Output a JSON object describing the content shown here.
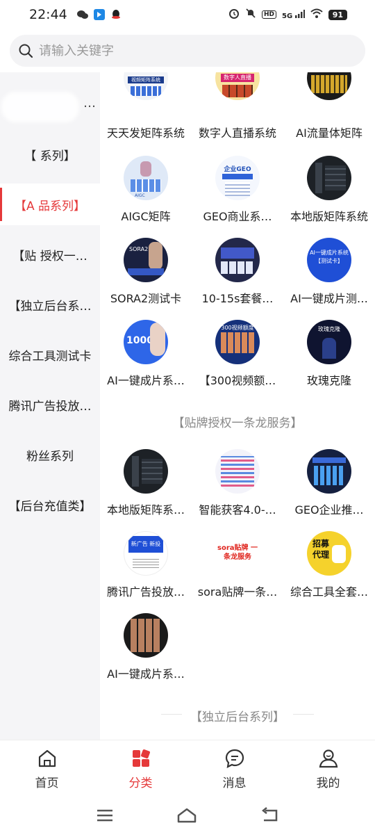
{
  "status": {
    "time": "22:44",
    "network": "5G",
    "hd": "HD",
    "battery": "91"
  },
  "search": {
    "placeholder": "请输入关键字"
  },
  "sidebar": {
    "items": [
      {
        "label": "…"
      },
      {
        "label": "【   系列】"
      },
      {
        "label": "【A   品系列】"
      },
      {
        "label": "【贴   授权一…"
      },
      {
        "label": "【独立后台系…"
      },
      {
        "label": "综合工具测试卡"
      },
      {
        "label": "腾讯广告投放…"
      },
      {
        "label": "粉丝系列"
      },
      {
        "label": "【后台充值类】"
      }
    ]
  },
  "sections": {
    "s1_items": [
      {
        "label": "天天发矩阵系统"
      },
      {
        "label": "数字人直播系统"
      },
      {
        "label": "AI流量体矩阵"
      },
      {
        "label": "AIGC矩阵"
      },
      {
        "label": "GEO商业系…"
      },
      {
        "label": "本地版矩阵系统"
      },
      {
        "label": "SORA2测试卡"
      },
      {
        "label": "10-15s套餐…"
      },
      {
        "label": "AI一键成片测…"
      },
      {
        "label": "AI一键成片系…"
      },
      {
        "label": "【300视频额…"
      },
      {
        "label": "玫瑰克隆"
      }
    ],
    "s2_title": "【贴牌授权一条龙服务】",
    "s2_items": [
      {
        "label": "本地版矩阵系…"
      },
      {
        "label": "智能获客4.0-…"
      },
      {
        "label": "GEO企业推…"
      },
      {
        "label": "腾讯广告投放…"
      },
      {
        "label": "sora贴牌一条…"
      },
      {
        "label": "综合工具全套…"
      },
      {
        "label": "AI一键成片系…"
      }
    ],
    "s3_title": "【独立后台系列】"
  },
  "thumb_texts": {
    "t1": "视频矩阵系统",
    "t2": "数字人直播",
    "t4": "AIGC",
    "t5": "企业GEO",
    "t7": "SORA2",
    "t9": "AI一键成片系统 【测试卡】",
    "t10": "1000",
    "t11": "300视频额度",
    "t12": "玫瑰克隆",
    "t17": "sora贴牌 一条龙服务",
    "t18": "招募 代理",
    "t16": "新广告 新投放"
  },
  "tabbar": {
    "home": "首页",
    "category": "分类",
    "message": "消息",
    "mine": "我的"
  },
  "colors": {
    "accent": "#e5393a",
    "sidebar_bg": "#f5f5f7",
    "search_bg": "#f3f3f5"
  }
}
